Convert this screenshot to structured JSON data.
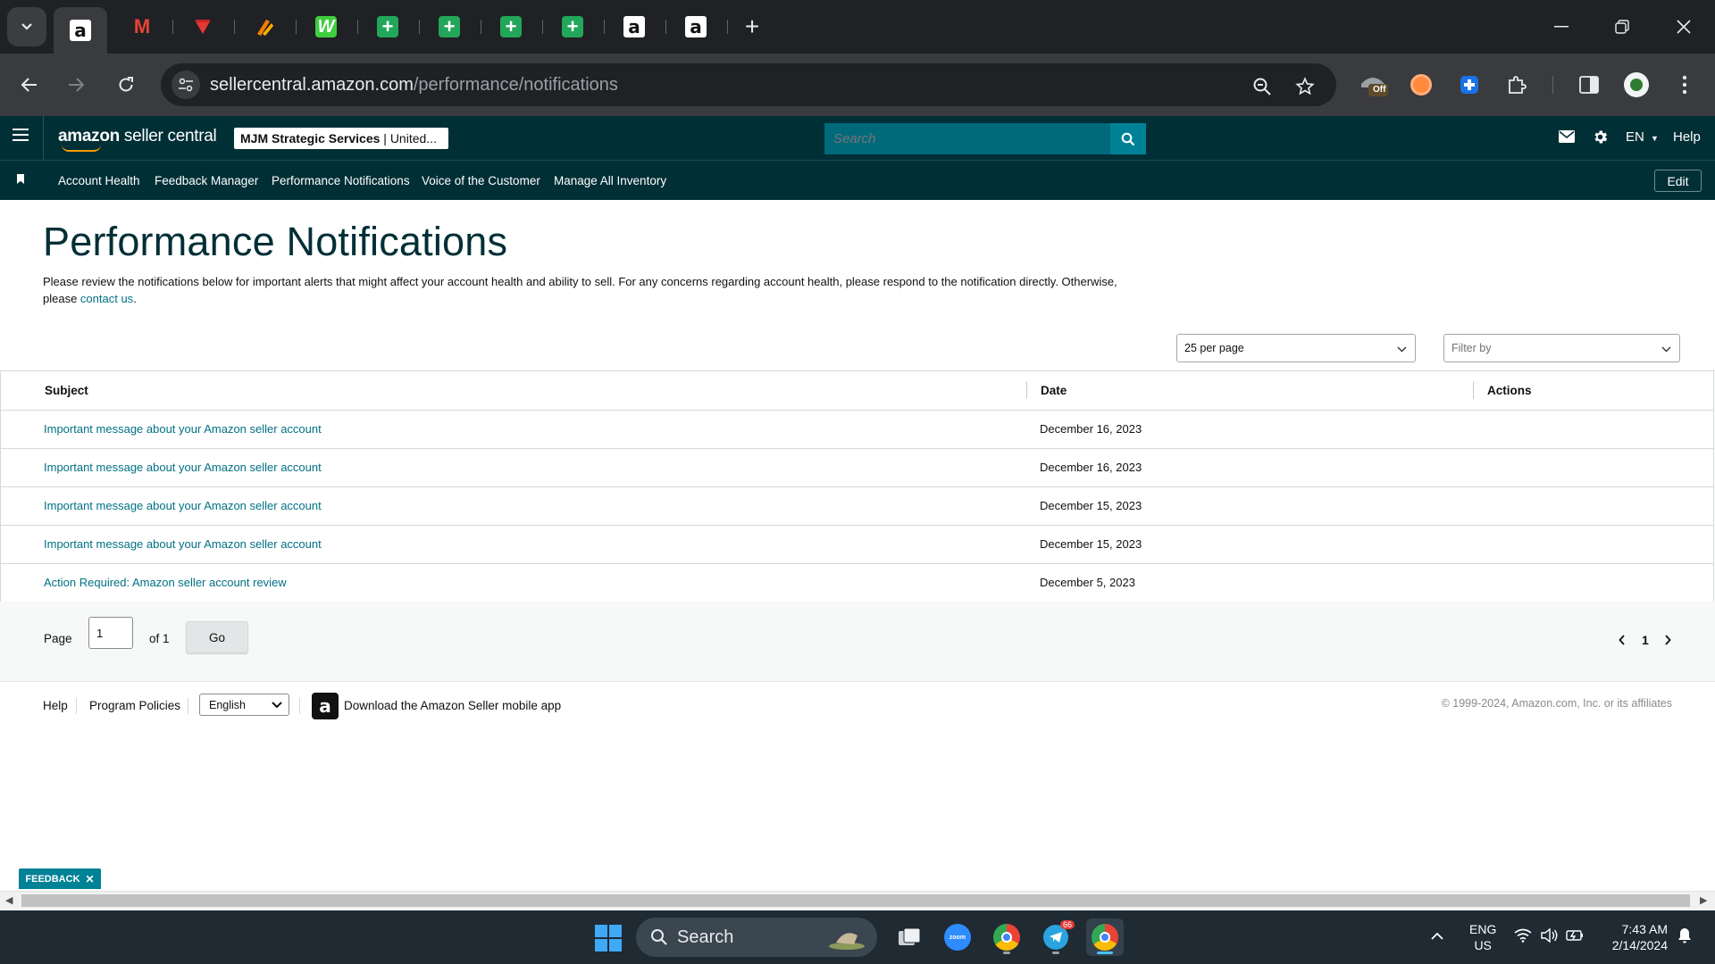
{
  "browser": {
    "tabs": [
      {
        "icon": "amazon-favicon",
        "active": true
      },
      {
        "icon": "gmail-favicon"
      },
      {
        "icon": "red-pin-favicon"
      },
      {
        "icon": "orange-tool-favicon"
      },
      {
        "icon": "w-favicon"
      },
      {
        "icon": "sheets-favicon"
      },
      {
        "icon": "sheets-favicon"
      },
      {
        "icon": "sheets-favicon"
      },
      {
        "icon": "sheets-favicon"
      },
      {
        "icon": "amazon-favicon"
      },
      {
        "icon": "amazon-favicon"
      }
    ],
    "url_host": "sellercentral.amazon.com",
    "url_path": "/performance/notifications",
    "extension_badge": "Off"
  },
  "amazon": {
    "logo_brand": "amazon",
    "logo_product": " seller central",
    "store_name": "MJM Strategic Services",
    "store_region": " | United...",
    "search_placeholder": "Search",
    "language": "EN",
    "help": "Help",
    "nav": [
      "Account Health",
      "Feedback Manager",
      "Performance Notifications",
      "Voice of the Customer",
      "Manage All Inventory"
    ],
    "edit": "Edit"
  },
  "page": {
    "title": "Performance Notifications",
    "intro_text": "Please review the notifications below for important alerts that might affect your account health and ability to sell. For any concerns regarding account health, please respond to the notification directly. Otherwise, please ",
    "intro_link": "contact us",
    "intro_end": ".",
    "per_page": "25 per page",
    "filter_placeholder": "Filter by",
    "columns": {
      "subject": "Subject",
      "date": "Date",
      "actions": "Actions"
    },
    "rows": [
      {
        "subject": "Important message about your Amazon seller account",
        "date": "December 16, 2023"
      },
      {
        "subject": "Important message about your Amazon seller account",
        "date": "December 16, 2023"
      },
      {
        "subject": "Important message about your Amazon seller account",
        "date": "December 15, 2023"
      },
      {
        "subject": "Important message about your Amazon seller account",
        "date": "December 15, 2023"
      },
      {
        "subject": "Action Required: Amazon seller account review",
        "date": "December 5, 2023"
      }
    ],
    "pager": {
      "page_label": "Page",
      "page_value": "1",
      "of_label": "of 1",
      "go": "Go",
      "current": "1"
    }
  },
  "footer": {
    "help": "Help",
    "policies": "Program Policies",
    "language": "English",
    "app_text": "Download the Amazon Seller mobile app",
    "copyright": "© 1999-2024, Amazon.com, Inc. or its affiliates"
  },
  "feedback": "FEEDBACK",
  "taskbar": {
    "search": "Search",
    "lang_top": "ENG",
    "lang_bottom": "US",
    "time": "7:43 AM",
    "date": "2/14/2024",
    "telegram_badge": "66"
  },
  "colors": {
    "header_bg": "#002f36",
    "link": "#007185",
    "search_btn": "#008296",
    "title": "#002f36"
  }
}
